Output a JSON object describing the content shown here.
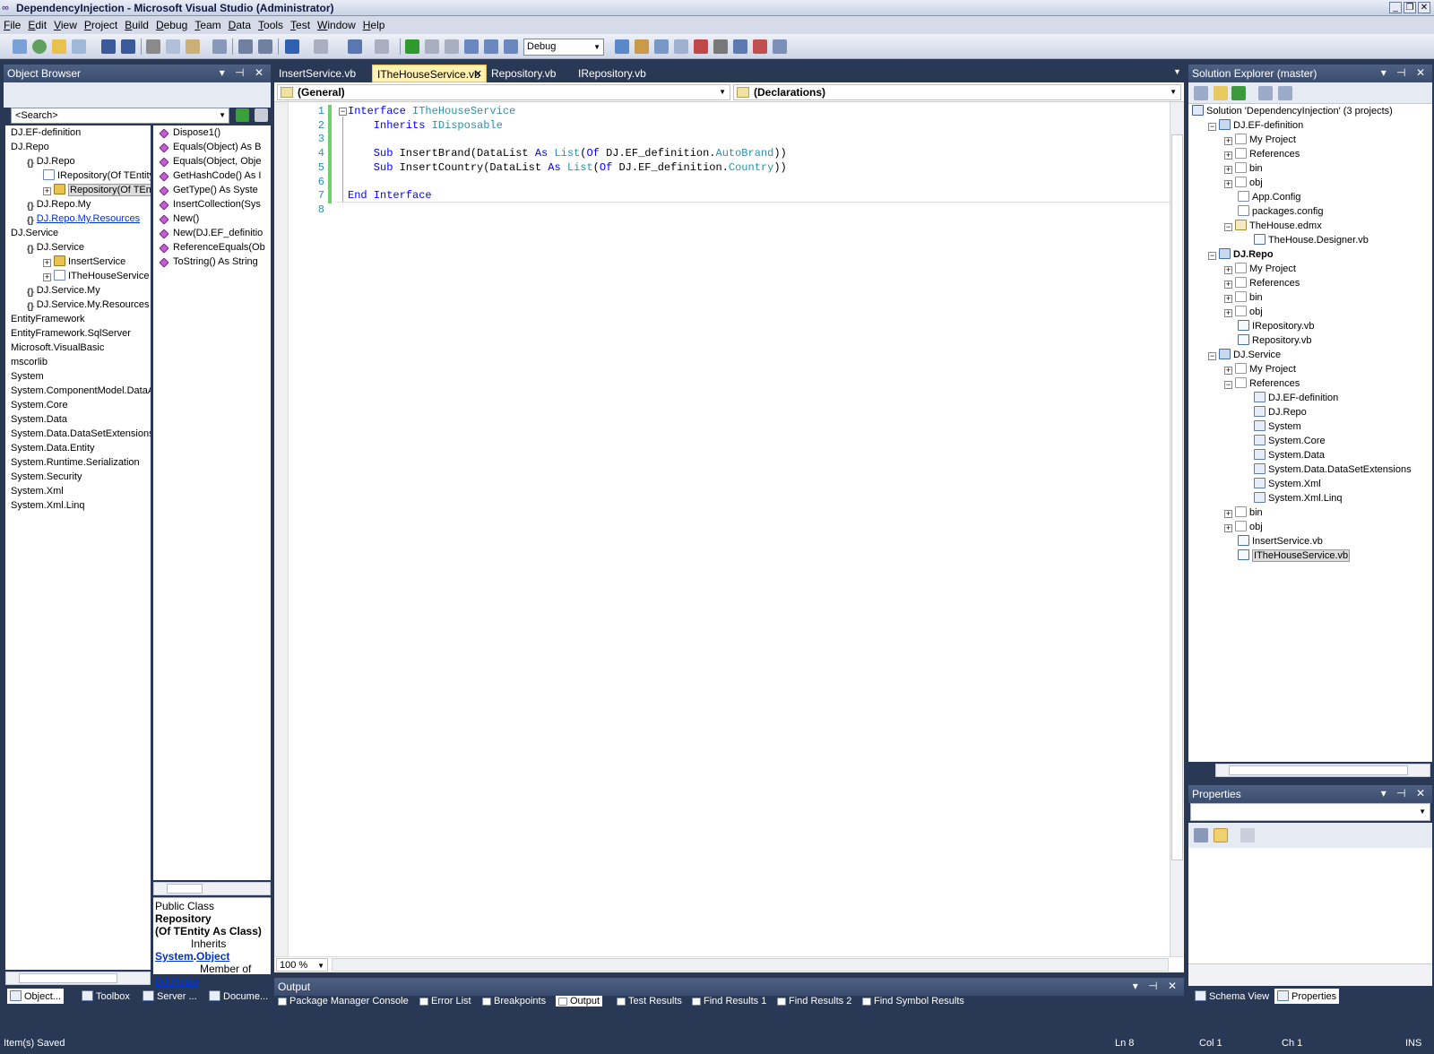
{
  "window": {
    "title": "DependencyInjection - Microsoft Visual Studio (Administrator)"
  },
  "menu": [
    "File",
    "Edit",
    "View",
    "Project",
    "Build",
    "Debug",
    "Team",
    "Data",
    "Tools",
    "Test",
    "Window",
    "Help"
  ],
  "toolbar": {
    "config": "Debug"
  },
  "object_browser": {
    "title": "Object Browser",
    "search_placeholder": "<Search>",
    "tree": [
      {
        "label": "DJ.EF-definition",
        "indent": 0,
        "icon": "none"
      },
      {
        "label": "DJ.Repo",
        "indent": 0,
        "icon": "none"
      },
      {
        "label": "DJ.Repo",
        "indent": 1,
        "icon": "namespace"
      },
      {
        "label": "IRepository(Of TEntity)",
        "indent": 2,
        "icon": "interface"
      },
      {
        "label": "Repository(Of TEntity)",
        "indent": 2,
        "icon": "class",
        "expander": "+",
        "selected": true
      },
      {
        "label": "DJ.Repo.My",
        "indent": 1,
        "icon": "namespace"
      },
      {
        "label": "DJ.Repo.My.Resources",
        "indent": 1,
        "icon": "namespace",
        "link": true
      },
      {
        "label": "DJ.Service",
        "indent": 0,
        "icon": "none"
      },
      {
        "label": "DJ.Service",
        "indent": 1,
        "icon": "namespace"
      },
      {
        "label": "InsertService",
        "indent": 2,
        "icon": "class",
        "expander": "+"
      },
      {
        "label": "ITheHouseService",
        "indent": 2,
        "icon": "interface",
        "expander": "+"
      },
      {
        "label": "DJ.Service.My",
        "indent": 1,
        "icon": "namespace"
      },
      {
        "label": "DJ.Service.My.Resources",
        "indent": 1,
        "icon": "namespace"
      },
      {
        "label": "EntityFramework",
        "indent": 0,
        "icon": "none"
      },
      {
        "label": "EntityFramework.SqlServer",
        "indent": 0,
        "icon": "none"
      },
      {
        "label": "Microsoft.VisualBasic",
        "indent": 0,
        "icon": "none"
      },
      {
        "label": "mscorlib",
        "indent": 0,
        "icon": "none"
      },
      {
        "label": "System",
        "indent": 0,
        "icon": "none"
      },
      {
        "label": "System.ComponentModel.DataA",
        "indent": 0,
        "icon": "none"
      },
      {
        "label": "System.Core",
        "indent": 0,
        "icon": "none"
      },
      {
        "label": "System.Data",
        "indent": 0,
        "icon": "none"
      },
      {
        "label": "System.Data.DataSetExtensions",
        "indent": 0,
        "icon": "none"
      },
      {
        "label": "System.Data.Entity",
        "indent": 0,
        "icon": "none"
      },
      {
        "label": "System.Runtime.Serialization",
        "indent": 0,
        "icon": "none"
      },
      {
        "label": "System.Security",
        "indent": 0,
        "icon": "none"
      },
      {
        "label": "System.Xml",
        "indent": 0,
        "icon": "none"
      },
      {
        "label": "System.Xml.Linq",
        "indent": 0,
        "icon": "none"
      }
    ],
    "members": [
      "Dispose1()",
      "Equals(Object) As B",
      "Equals(Object, Obje",
      "GetHashCode() As I",
      "GetType() As Syste",
      "InsertCollection(Sys",
      "New()",
      "New(DJ.EF_definitio",
      "ReferenceEquals(Ob",
      "ToString() As String"
    ],
    "description": {
      "line1a": "Public Class ",
      "line1b": "Repository",
      "line2": "(Of TEntity As Class)",
      "inherits": "Inherits",
      "inherits_a": "System",
      "dot": ".",
      "inherits_b": "Object",
      "member_of": "Member of",
      "member_link": "DJ.Repo"
    }
  },
  "editor": {
    "tabs": [
      "InsertService.vb",
      "ITheHouseService.vb",
      "Repository.vb",
      "IRepository.vb"
    ],
    "active_tab": 1,
    "close_glyph": "✕",
    "dropdown_left": "(General)",
    "dropdown_right": "(Declarations)",
    "line_numbers": [
      "1",
      "2",
      "3",
      "4",
      "5",
      "6",
      "7",
      "8"
    ],
    "zoom": "100 %",
    "code": [
      [
        {
          "t": "Interface ",
          "c": "kw"
        },
        {
          "t": "ITheHouseService",
          "c": "ty"
        }
      ],
      [
        {
          "t": "    Inherits ",
          "c": "kw"
        },
        {
          "t": "IDisposable",
          "c": "ty"
        }
      ],
      [],
      [
        {
          "t": "    Sub ",
          "c": "kw"
        },
        {
          "t": "InsertBrand(DataList ",
          "c": ""
        },
        {
          "t": "As ",
          "c": "kw"
        },
        {
          "t": "List",
          "c": "ty"
        },
        {
          "t": "(",
          "c": ""
        },
        {
          "t": "Of ",
          "c": "kw"
        },
        {
          "t": "DJ.EF_definition.",
          "c": ""
        },
        {
          "t": "AutoBrand",
          "c": "ty"
        },
        {
          "t": "))",
          "c": ""
        }
      ],
      [
        {
          "t": "    Sub ",
          "c": "kw"
        },
        {
          "t": "InsertCountry(DataList ",
          "c": ""
        },
        {
          "t": "As ",
          "c": "kw"
        },
        {
          "t": "List",
          "c": "ty"
        },
        {
          "t": "(",
          "c": ""
        },
        {
          "t": "Of ",
          "c": "kw"
        },
        {
          "t": "DJ.EF_definition.",
          "c": ""
        },
        {
          "t": "Country",
          "c": "ty"
        },
        {
          "t": "))",
          "c": ""
        }
      ],
      [],
      [
        {
          "t": "End Interface",
          "c": "kw"
        }
      ],
      []
    ]
  },
  "solution_explorer": {
    "title": "Solution Explorer (master)",
    "tree": [
      {
        "label": "Solution 'DependencyInjection' (3 projects)",
        "indent": 0,
        "icon": "solution"
      },
      {
        "label": "DJ.EF-definition",
        "indent": 1,
        "icon": "project",
        "expander": "-"
      },
      {
        "label": "My Project",
        "indent": 2,
        "icon": "folder",
        "expander": "+"
      },
      {
        "label": "References",
        "indent": 2,
        "icon": "folder",
        "expander": "+"
      },
      {
        "label": "bin",
        "indent": 2,
        "icon": "folder",
        "expander": "+"
      },
      {
        "label": "obj",
        "indent": 2,
        "icon": "folder",
        "expander": "+"
      },
      {
        "label": "App.Config",
        "indent": 2,
        "icon": "config"
      },
      {
        "label": "packages.config",
        "indent": 2,
        "icon": "config"
      },
      {
        "label": "TheHouse.edmx",
        "indent": 2,
        "icon": "edmx",
        "expander": "-"
      },
      {
        "label": "TheHouse.Designer.vb",
        "indent": 3,
        "icon": "vb"
      },
      {
        "label": "DJ.Repo",
        "indent": 1,
        "icon": "project",
        "expander": "-",
        "bold": true
      },
      {
        "label": "My Project",
        "indent": 2,
        "icon": "folder",
        "expander": "+"
      },
      {
        "label": "References",
        "indent": 2,
        "icon": "folder",
        "expander": "+"
      },
      {
        "label": "bin",
        "indent": 2,
        "icon": "folder",
        "expander": "+"
      },
      {
        "label": "obj",
        "indent": 2,
        "icon": "folder",
        "expander": "+"
      },
      {
        "label": "IRepository.vb",
        "indent": 2,
        "icon": "vb"
      },
      {
        "label": "Repository.vb",
        "indent": 2,
        "icon": "vb"
      },
      {
        "label": "DJ.Service",
        "indent": 1,
        "icon": "project",
        "expander": "-"
      },
      {
        "label": "My Project",
        "indent": 2,
        "icon": "folder",
        "expander": "+"
      },
      {
        "label": "References",
        "indent": 2,
        "icon": "folder",
        "expander": "-"
      },
      {
        "label": "DJ.EF-definition",
        "indent": 3,
        "icon": "reference"
      },
      {
        "label": "DJ.Repo",
        "indent": 3,
        "icon": "reference"
      },
      {
        "label": "System",
        "indent": 3,
        "icon": "reference"
      },
      {
        "label": "System.Core",
        "indent": 3,
        "icon": "reference"
      },
      {
        "label": "System.Data",
        "indent": 3,
        "icon": "reference"
      },
      {
        "label": "System.Data.DataSetExtensions",
        "indent": 3,
        "icon": "reference"
      },
      {
        "label": "System.Xml",
        "indent": 3,
        "icon": "reference"
      },
      {
        "label": "System.Xml.Linq",
        "indent": 3,
        "icon": "reference"
      },
      {
        "label": "bin",
        "indent": 2,
        "icon": "folder",
        "expander": "+"
      },
      {
        "label": "obj",
        "indent": 2,
        "icon": "folder",
        "expander": "+"
      },
      {
        "label": "InsertService.vb",
        "indent": 2,
        "icon": "vb"
      },
      {
        "label": "ITheHouseService.vb",
        "indent": 2,
        "icon": "vb",
        "selected": true
      }
    ]
  },
  "properties": {
    "title": "Properties"
  },
  "output": {
    "title": "Output"
  },
  "bottom_left_tabs": [
    "Object...",
    "Toolbox",
    "Server ...",
    "Docume..."
  ],
  "output_tabs": [
    "Package Manager Console",
    "Error List",
    "Breakpoints",
    "Output",
    "Test Results",
    "Find Results 1",
    "Find Results 2",
    "Find Symbol Results"
  ],
  "bottom_right_tabs": [
    "Schema View",
    "Properties"
  ],
  "status": {
    "message": "Item(s) Saved",
    "ln": "Ln 8",
    "col": "Col 1",
    "ch": "Ch 1",
    "mode": "INS"
  },
  "colors": {
    "keyword": "#0000ff",
    "type": "#2b91af",
    "frame": "#293955",
    "active_tab": "#fff1b0"
  }
}
